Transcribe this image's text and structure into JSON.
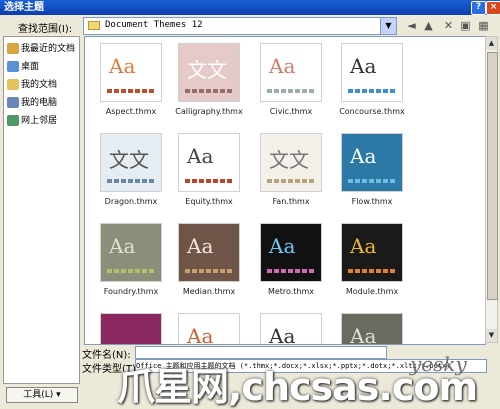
{
  "window": {
    "title": "选择主题",
    "help_label": "?",
    "close_label": "×"
  },
  "lookin": {
    "label": "查找范围(I):",
    "value": "Document Themes 12"
  },
  "toolbar": {
    "back": "◄",
    "up": "▲",
    "delete": "✕",
    "newfolder": "▣",
    "views": "▦"
  },
  "places": [
    {
      "label": "我最近的文档",
      "color": "#d9a441"
    },
    {
      "label": "桌面",
      "color": "#5b8fd6"
    },
    {
      "label": "我的文档",
      "color": "#e3c15c"
    },
    {
      "label": "我的电脑",
      "color": "#6a86b8"
    },
    {
      "label": "网上邻居",
      "color": "#4f9a64"
    }
  ],
  "items": [
    {
      "label": "Aspect.thmx",
      "bg": "#ffffff",
      "aa_text": "Aa",
      "aa_color": "#e07a3a",
      "swatch": "#c44b2b"
    },
    {
      "label": "Calligraphy.thmx",
      "bg": "#e6c9c9",
      "aa_text": "文文",
      "aa_color": "#ffffff",
      "swatch": "#9a6b6b"
    },
    {
      "label": "Civic.thmx",
      "bg": "#ffffff",
      "aa_text": "Aa",
      "aa_color": "#d47a6a",
      "swatch": "#9ab0a0"
    },
    {
      "label": "Concourse.thmx",
      "bg": "#ffffff",
      "aa_text": "Aa",
      "aa_color": "#333333",
      "swatch": "#3a8fd6"
    },
    {
      "label": "Dragon.thmx",
      "bg": "#e5edf3",
      "aa_text": "文文",
      "aa_color": "#555555",
      "swatch": "#6a8aa8"
    },
    {
      "label": "Equity.thmx",
      "bg": "#ffffff",
      "aa_text": "Aa",
      "aa_color": "#444444",
      "swatch": "#c0442a"
    },
    {
      "label": "Fan.thmx",
      "bg": "#f3f1ea",
      "aa_text": "文文",
      "aa_color": "#777777",
      "swatch": "#b7a27a"
    },
    {
      "label": "Flow.thmx",
      "bg": "#2c79a8",
      "aa_text": "Aa",
      "aa_color": "#ffffff",
      "swatch": "#6dc0e0"
    },
    {
      "label": "Foundry.thmx",
      "bg": "#8c8e7a",
      "aa_text": "Aa",
      "aa_color": "#e0e0d4",
      "swatch": "#b4c06a"
    },
    {
      "label": "Median.thmx",
      "bg": "#6e5548",
      "aa_text": "Aa",
      "aa_color": "#f0e6dc",
      "swatch": "#c89e6a"
    },
    {
      "label": "Metro.thmx",
      "bg": "#111111",
      "aa_text": "Aa",
      "aa_color": "#6ec9f0",
      "swatch": "#d06ab0"
    },
    {
      "label": "Module.thmx",
      "bg": "#1a1a1a",
      "aa_text": "Aa",
      "aa_color": "#f0b830",
      "swatch": "#e08030"
    },
    {
      "label": "",
      "bg": "#8a2a60",
      "aa_text": "",
      "aa_color": "#ffffff",
      "swatch": "#8a2a60"
    },
    {
      "label": "",
      "bg": "#ffffff",
      "aa_text": "Aa",
      "aa_color": "#d06030",
      "swatch": "#d06030"
    },
    {
      "label": "",
      "bg": "#ffffff",
      "aa_text": "Aa",
      "aa_color": "#333333",
      "swatch": "#555555"
    },
    {
      "label": "",
      "bg": "#6b6a60",
      "aa_text": "Aa",
      "aa_color": "#e0e0d8",
      "swatch": "#9a988a"
    }
  ],
  "filename": {
    "label": "文件名(N):",
    "value": ""
  },
  "filetype": {
    "label": "文件类型(T):",
    "value": "Office 主题和应用主题的文档 (*.thmx;*.docx;*.xlsx;*.pptx;*.dotx;*.xltx;*.potx)"
  },
  "tools_button": {
    "label": "工具(L) ▾"
  },
  "watermark": {
    "text": "爪星网,chcsas.com",
    "logo": "yesky"
  }
}
